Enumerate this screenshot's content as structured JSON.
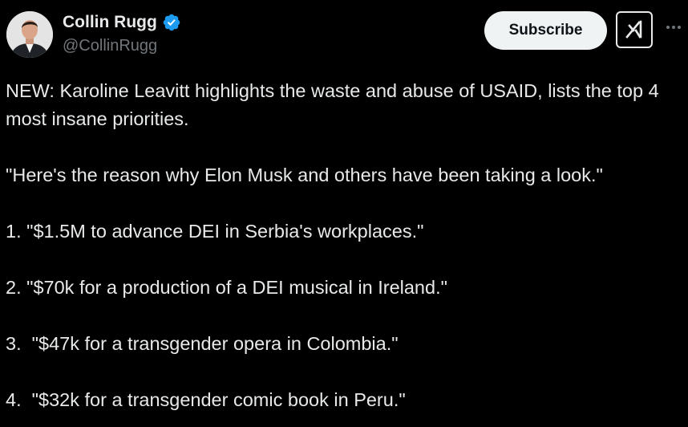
{
  "author": {
    "display_name": "Collin Rugg",
    "handle": "@CollinRugg",
    "verified": true,
    "avatar_icon": "avatar-man-in-suit-icon"
  },
  "actions": {
    "subscribe_label": "Subscribe",
    "grok_icon": "grok-icon",
    "more_icon": "more-options-icon"
  },
  "tweet": {
    "intro": "NEW: Karoline Leavitt highlights the waste and abuse of USAID, lists the top 4 most insane priorities.",
    "quote": "\"Here's the reason why Elon Musk and others have been taking a look.\"",
    "items": [
      "1. \"$1.5M to advance DEI in Serbia's workplaces.\"",
      "2. \"$70k for a production of a DEI musical in Ireland.\"",
      "3.  \"$47k for a transgender opera in Colombia.\"",
      "4.  \"$32k for a transgender comic book in Peru.\""
    ]
  },
  "colors": {
    "background": "#000000",
    "text": "#e7e9ea",
    "secondary_text": "#71767b",
    "verified_badge": "#1d9bf0",
    "subscribe_bg": "#eff3f4"
  }
}
